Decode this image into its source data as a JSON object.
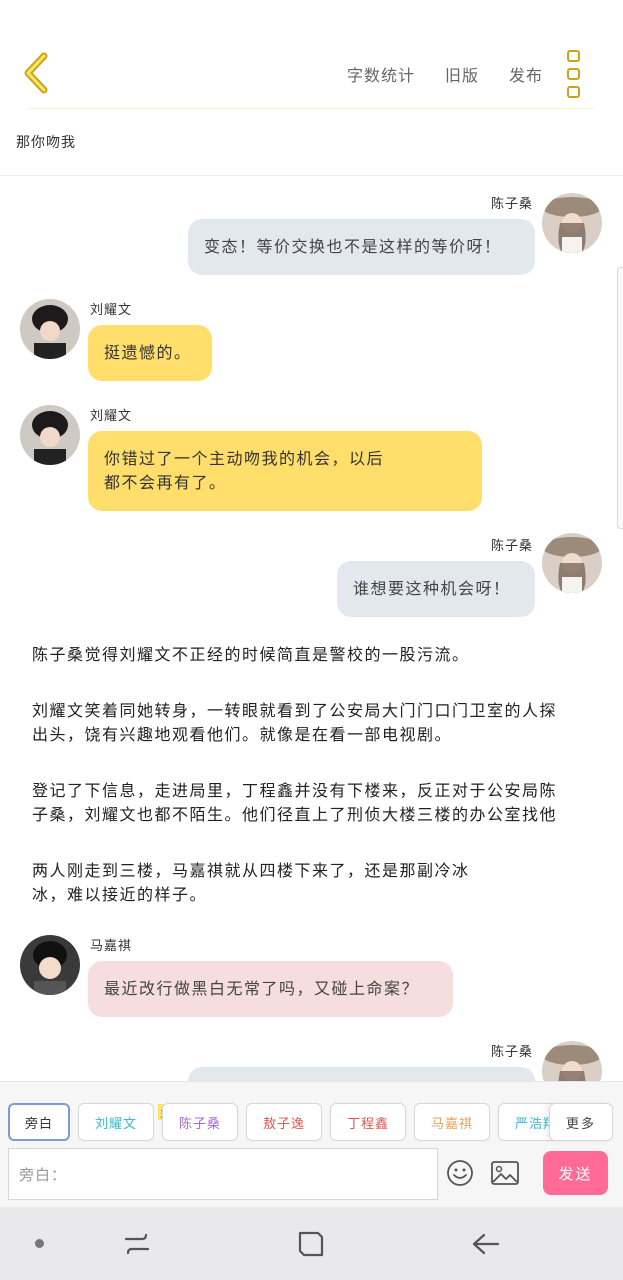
{
  "header": {
    "back_icon": "chevron-left-icon",
    "toolbar": {
      "word_count": "字数统计",
      "old_version": "旧版",
      "publish": "发布"
    },
    "more_icon": "more-vertical-icon",
    "story_title": "那你吻我"
  },
  "messages": [
    {
      "speaker": "陈子桑",
      "text": "变态！等价交换也不是这样的等价呀！"
    },
    {
      "speaker": "刘耀文",
      "text": "挺遗憾的。"
    },
    {
      "speaker": "刘耀文",
      "line1": "你错过了一个主动吻我的机会，以后",
      "line2": "都不会再有了。"
    },
    {
      "speaker": "陈子桑",
      "text": "谁想要这种机会呀！"
    },
    {
      "speaker": "马嘉祺",
      "text": "最近改行做黑白无常了吗，又碰上命案？"
    },
    {
      "speaker": "陈子桑",
      "text": ""
    }
  ],
  "narrations": [
    {
      "line1": "陈子桑觉得刘耀文不正经的时候简直是警校的一股污流。",
      "line2": ""
    },
    {
      "line1": "刘耀文笑着同她转身，一转眼就看到了公安局大门门口门卫室的人探",
      "line2": "出头，饶有兴趣地观看他们。就像是在看一部电视剧。"
    },
    {
      "line1": "登记了下信息，走进局里，丁程鑫并没有下楼来，反正对于公安局陈",
      "line2": "子桑，刘耀文也都不陌生。他们径直上了刑侦大楼三楼的办公室找他"
    },
    {
      "line1": "两人刚走到三楼，马嘉祺就从四楼下来了，还是那副冷冰",
      "line2": "冰，难以接近的样子。"
    }
  ],
  "roles": {
    "items": [
      {
        "label": "旁白",
        "color": "#333333"
      },
      {
        "label": "刘耀文",
        "color": "#3cb8c9"
      },
      {
        "label": "陈子桑",
        "color": "#a86cd6"
      },
      {
        "label": "敖子逸",
        "color": "#e0584e"
      },
      {
        "label": "丁程鑫",
        "color": "#e0584e"
      },
      {
        "label": "马嘉祺",
        "color": "#e8a060"
      },
      {
        "label": "严浩翔",
        "color": "#3cb8c9"
      }
    ],
    "main_tag": "主",
    "more_label": "更多"
  },
  "input": {
    "placeholder": "旁白：",
    "emoji_icon": "smiley-icon",
    "image_icon": "image-icon",
    "send_label": "发送",
    "send_color": "#ff6a96"
  },
  "navbar": {
    "dot_icon": "dot-icon",
    "recent_icon": "recent-apps-icon",
    "home_icon": "home-icon",
    "back_icon": "back-arrow-icon"
  },
  "colors": {
    "accent_yellow": "#ffde6b",
    "bubble_right": "#e3e8ef",
    "bubble_pink": "#f5dedd"
  }
}
